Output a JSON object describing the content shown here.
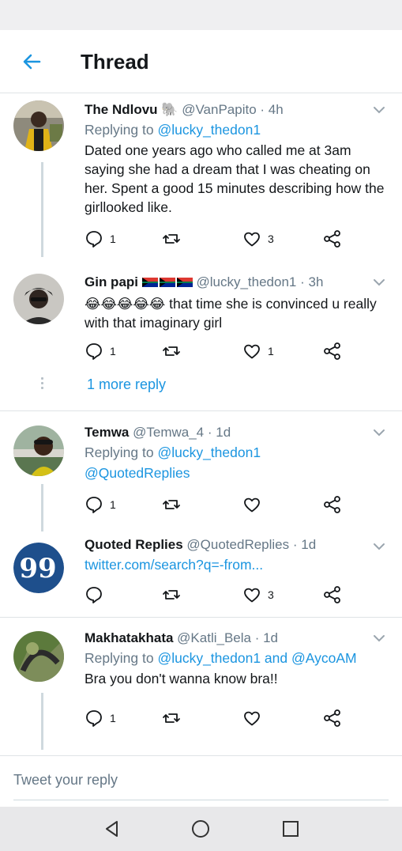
{
  "header": {
    "title": "Thread"
  },
  "tweets": [
    {
      "name": "The Ndlovu",
      "name_emoji": "🐘",
      "handle": "@VanPapito",
      "time": "· 4h",
      "reply_prefix": "Replying to",
      "reply_handle": "@lucky_thedon1",
      "body": "Dated one years ago who called me at 3am saying she had a dream that I was cheating on her. Spent a good 15 minutes describing how the girllooked like.",
      "replies": "1",
      "retweets": "",
      "likes": "3"
    },
    {
      "name": "Gin papi",
      "handle": "@lucky_thedon1",
      "time": "· 3h",
      "emoji_prefix": "😂😂😂😂😂",
      "body": " that time she is convinced  u really with that imaginary girl",
      "replies": "1",
      "retweets": "",
      "likes": "1"
    },
    {
      "name": "Temwa",
      "handle": "@Temwa_4",
      "time": "· 1d",
      "reply_prefix": "Replying to",
      "reply_handle": "@lucky_thedon1",
      "body": "@QuotedReplies",
      "replies": "1",
      "retweets": "",
      "likes": ""
    },
    {
      "name": "Quoted Replies",
      "handle": "@QuotedReplies",
      "time": "· 1d",
      "body": "twitter.com/search?q=-from...",
      "replies": "",
      "retweets": "",
      "likes": "3"
    },
    {
      "name": "Makhatakhata",
      "handle": "@Katli_Bela",
      "time": "· 1d",
      "reply_prefix": "Replying to",
      "reply_handle": "@lucky_thedon1 and @AycoAM",
      "body": "Bra you don't wanna know bra!!",
      "replies": "1",
      "retweets": "",
      "likes": ""
    }
  ],
  "more_replies": "1 more reply",
  "reply_bar": {
    "placeholder": "Tweet your reply"
  },
  "colors": {
    "accent": "#1b95e0",
    "text": "#14171a",
    "muted": "#657786",
    "divider": "#dfe3e6"
  }
}
